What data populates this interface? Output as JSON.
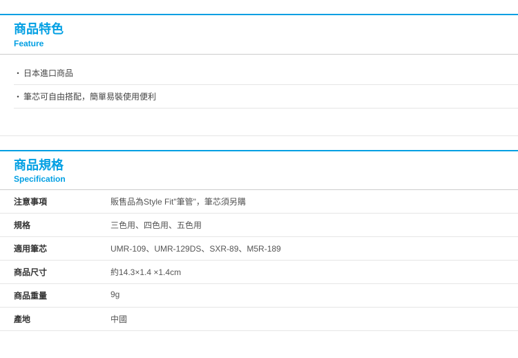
{
  "feature": {
    "title_zh": "商品特色",
    "title_en": "Feature",
    "items": [
      "日本進口商品",
      "筆芯可自由搭配，簡單易裝使用便利"
    ]
  },
  "spec": {
    "title_zh": "商品規格",
    "title_en": "Specification",
    "rows": [
      {
        "label": "注意事項",
        "value": "販售品為Style Fit\"筆管\"，筆芯須另購"
      },
      {
        "label": "規格",
        "value": "三色用、四色用、五色用"
      },
      {
        "label": "適用筆芯",
        "value": "UMR-109、UMR-129DS、SXR-89、M5R-189"
      },
      {
        "label": "商品尺寸",
        "value": "約14.3×1.4 ×1.4cm"
      },
      {
        "label": "商品重量",
        "value": "9g"
      },
      {
        "label": "產地",
        "value": "中國"
      }
    ]
  }
}
